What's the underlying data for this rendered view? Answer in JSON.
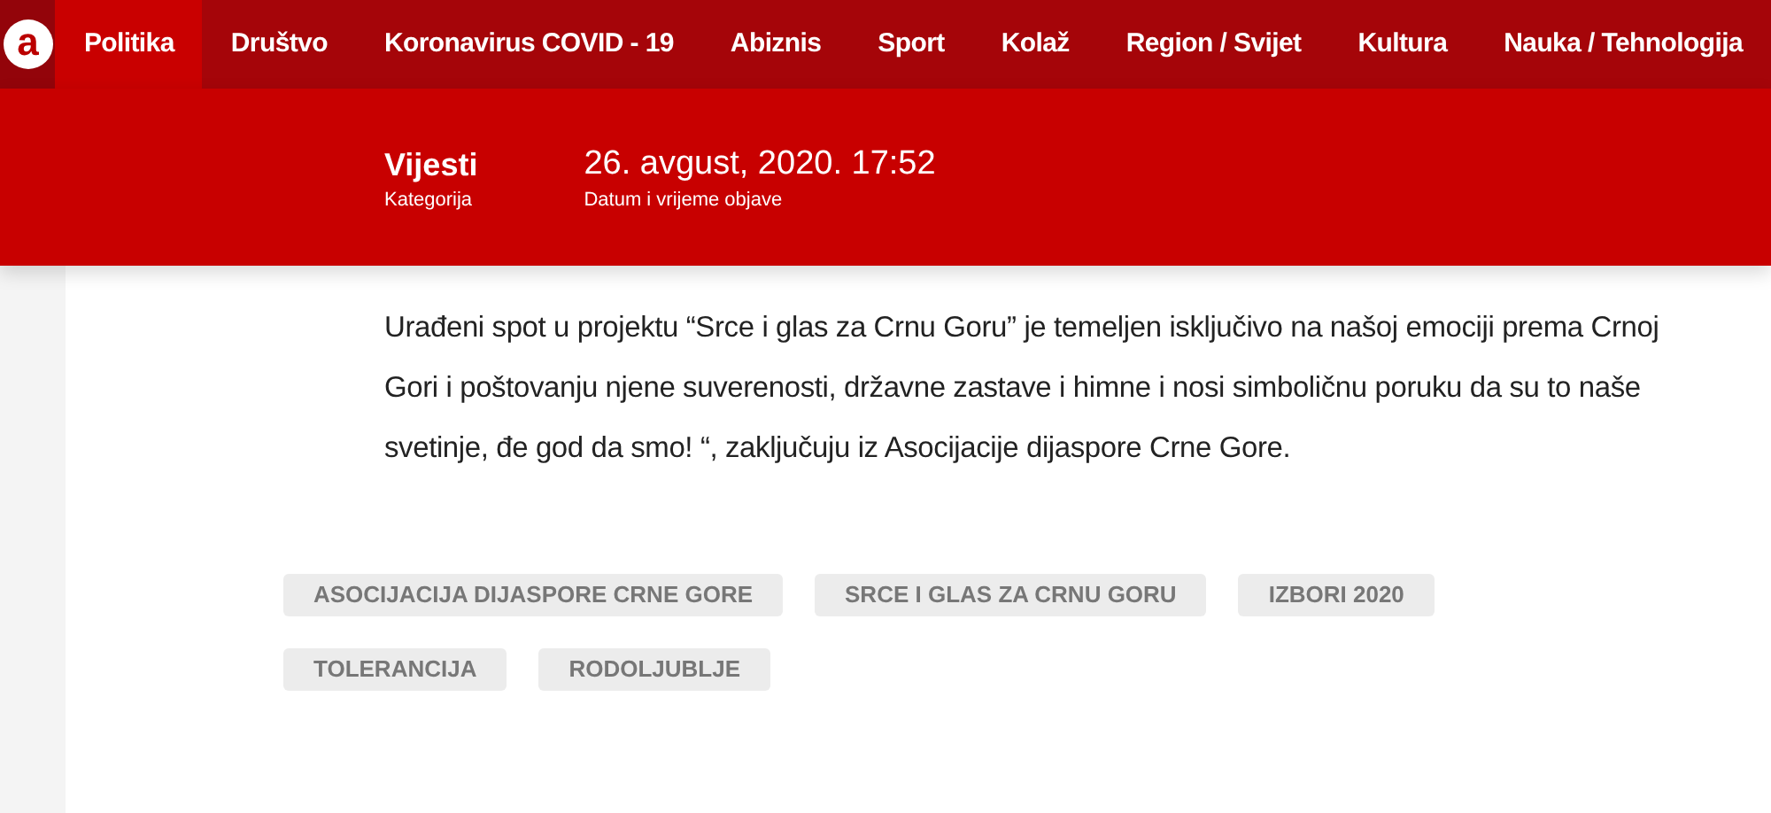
{
  "nav": {
    "logo": "a",
    "items": [
      {
        "label": "Politika",
        "selected": true
      },
      {
        "label": "Društvo",
        "selected": false
      },
      {
        "label": "Koronavirus COVID - 19",
        "selected": false
      },
      {
        "label": "Abiznis",
        "selected": false
      },
      {
        "label": "Sport",
        "selected": false
      },
      {
        "label": "Kolaž",
        "selected": false
      },
      {
        "label": "Region / Svijet",
        "selected": false
      },
      {
        "label": "Kultura",
        "selected": false
      },
      {
        "label": "Nauka / Tehnologija",
        "selected": false
      }
    ]
  },
  "meta": [
    {
      "value": "Vijesti",
      "label": "Kategorija",
      "kind": "category"
    },
    {
      "value": "26. avgust, 2020. 17:52",
      "label": "Datum i vrijeme objave",
      "kind": "date"
    }
  ],
  "article": {
    "paragraph": "Urađeni spot u projektu “Srce i glas za Crnu Goru” je temeljen isključivo na našoj emociji prema Crnoj Gori i poštovanju njene suverenosti, državne zastave i himne i nosi simboličnu poruku da su to naše svetinje, đe god da smo! “, zaključuju iz Asocijacije dijaspore Crne Gore."
  },
  "tags": [
    "ASOCIJACIJA DIJASPORE CRNE GORE",
    "SRCE I GLAS ZA CRNU GORU",
    "IZBORI 2020",
    "TOLERANCIJA",
    "RODOLJUBLJE"
  ]
}
